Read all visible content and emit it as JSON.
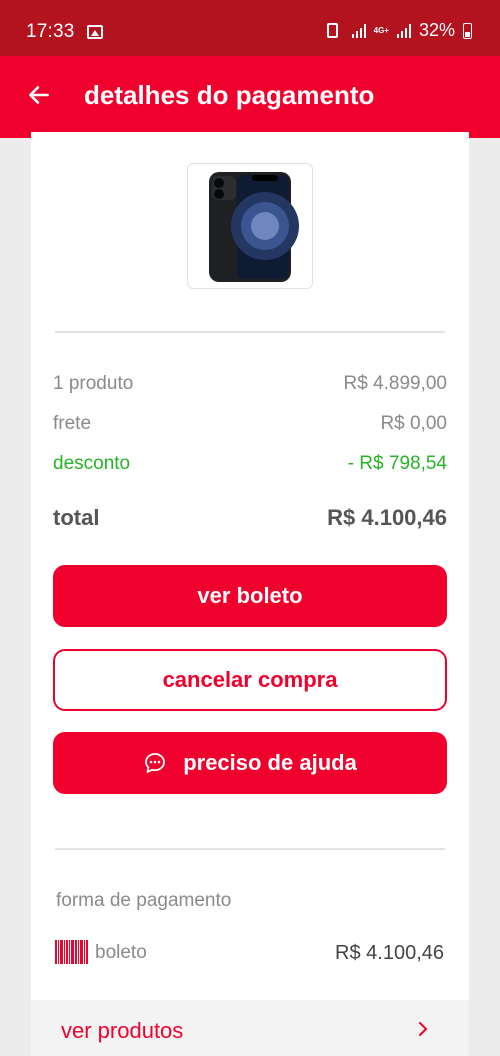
{
  "status_bar": {
    "time": "17:33",
    "battery": "32%",
    "network": "4G+",
    "icons": [
      "image-icon",
      "record-icon",
      "signal-icon",
      "battery-icon"
    ]
  },
  "app_bar": {
    "title": "detalhes do pagamento",
    "back_icon": "arrow-left-icon"
  },
  "summary": {
    "product_label": "1 produto",
    "product_value": "R$ 4.899,00",
    "shipping_label": "frete",
    "shipping_value": "R$ 0,00",
    "discount_label": "desconto",
    "discount_value": "- R$ 798,54",
    "total_label": "total",
    "total_value": "R$ 4.100,46"
  },
  "actions": {
    "view_boleto": "ver boleto",
    "cancel_purchase": "cancelar compra",
    "need_help": "preciso de ajuda"
  },
  "payment": {
    "section_label": "forma de pagamento",
    "method": "boleto",
    "amount": "R$ 4.100,46"
  },
  "products_link": {
    "label": "ver produtos"
  },
  "colors": {
    "brand_red": "#f0002c",
    "status_bar": "#b3121f",
    "discount_green": "#27b427"
  }
}
